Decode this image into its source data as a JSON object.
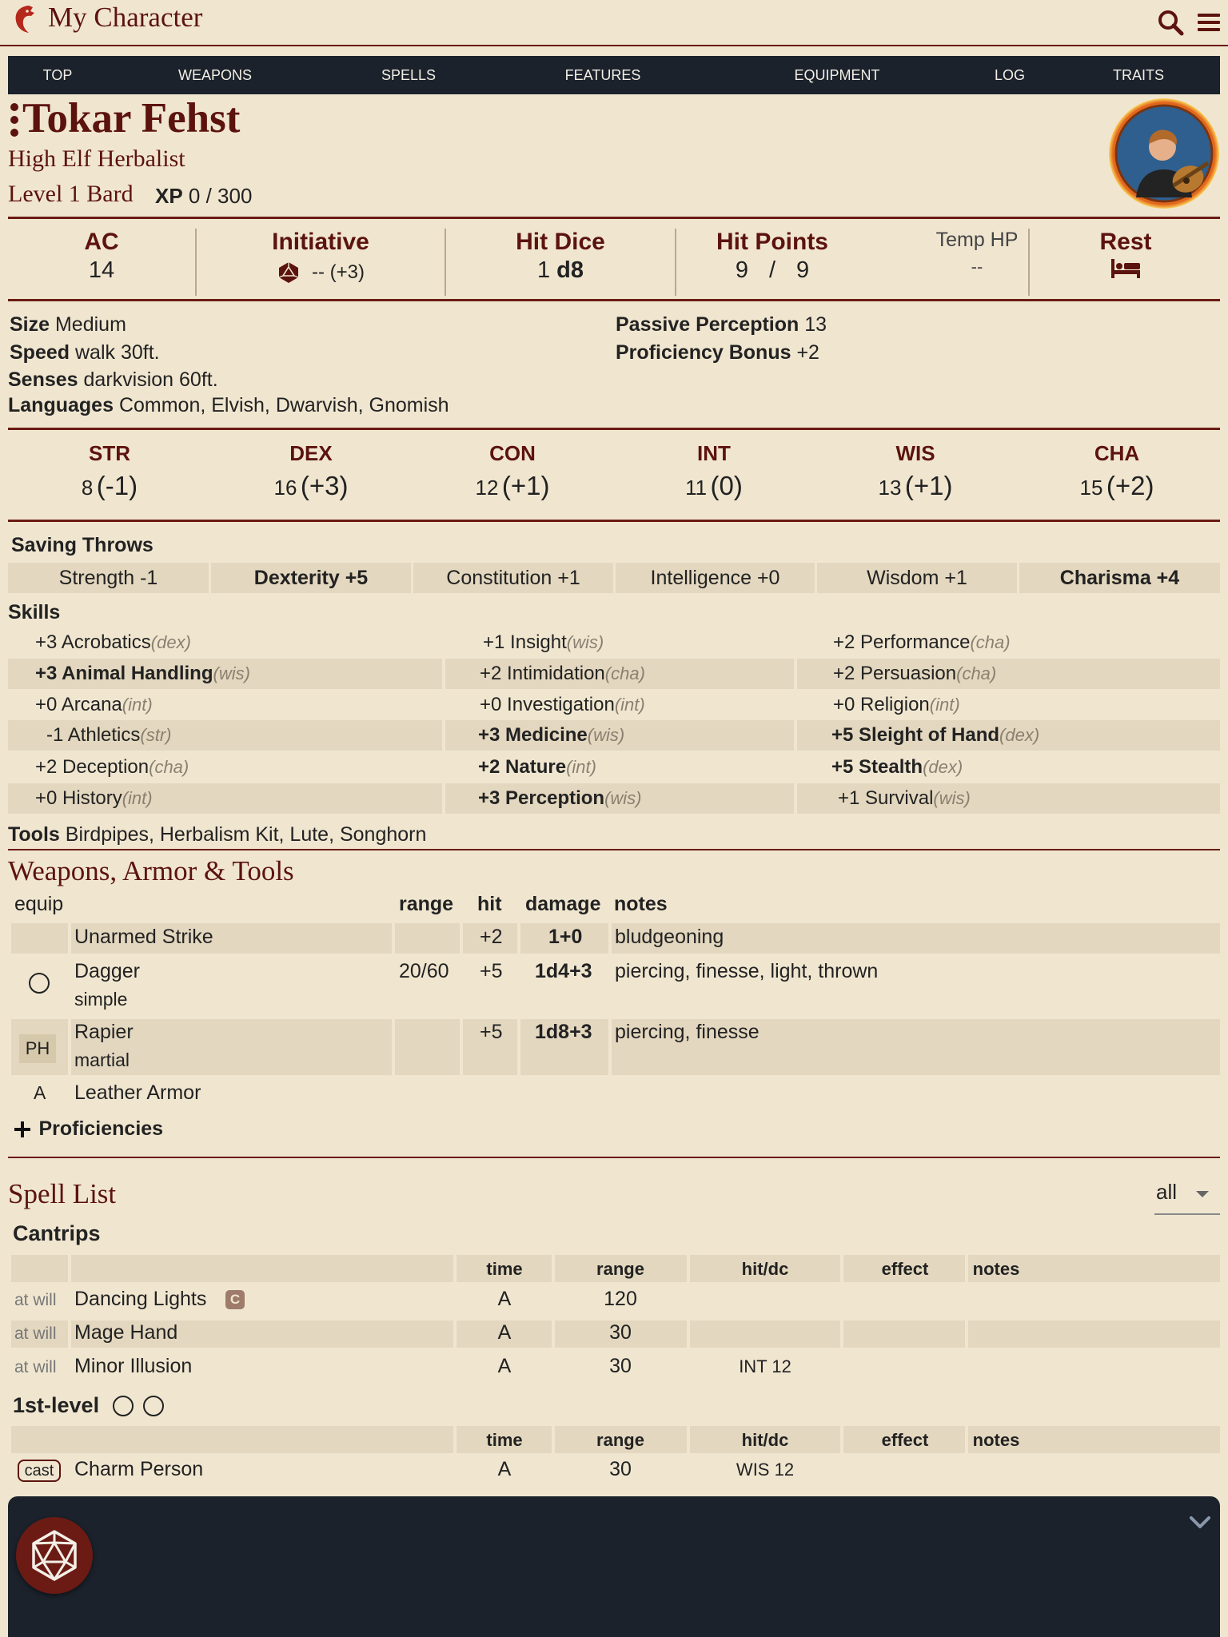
{
  "app": {
    "title": "My Character"
  },
  "nav": {
    "items": [
      "TOP",
      "WEAPONS",
      "SPELLS",
      "FEATURES",
      "EQUIPMENT",
      "LOG",
      "TRAITS"
    ]
  },
  "character": {
    "name": "Tokar Fehst",
    "subtitle": "High Elf Herbalist",
    "level_class": "Level 1 Bard",
    "xp_label": "XP",
    "xp_value": "0 / 300"
  },
  "stats": {
    "ac_label": "AC",
    "ac_value": "14",
    "initiative_label": "Initiative",
    "initiative_value": "-- (+3)",
    "hit_dice_label": "Hit Dice",
    "hit_dice_count": "1",
    "hit_dice_die": "d8",
    "hit_points_label": "Hit Points",
    "hp_current": "9",
    "hp_sep": "/",
    "hp_max": "9",
    "temp_hp_label": "Temp HP",
    "temp_hp_value": "--",
    "rest_label": "Rest"
  },
  "info": {
    "size_label": "Size",
    "size_value": "Medium",
    "speed_label": "Speed",
    "speed_value": "walk 30ft.",
    "senses_label": "Senses",
    "senses_value": "darkvision 60ft.",
    "languages_label": "Languages",
    "languages_value": "Common, Elvish, Dwarvish, Gnomish",
    "passive_label": "Passive Perception",
    "passive_value": "13",
    "prof_label": "Proficiency Bonus",
    "prof_value": "+2"
  },
  "abilities": [
    {
      "label": "STR",
      "score": "8",
      "mod": "(-1)"
    },
    {
      "label": "DEX",
      "score": "16",
      "mod": "(+3)"
    },
    {
      "label": "CON",
      "score": "12",
      "mod": "(+1)"
    },
    {
      "label": "INT",
      "score": "11",
      "mod": "(0)"
    },
    {
      "label": "WIS",
      "score": "13",
      "mod": "(+1)"
    },
    {
      "label": "CHA",
      "score": "15",
      "mod": "(+2)"
    }
  ],
  "saving_throws": {
    "title": "Saving Throws",
    "items": [
      {
        "label": "Strength -1",
        "proficient": false
      },
      {
        "label": "Dexterity +5",
        "proficient": true
      },
      {
        "label": "Constitution +1",
        "proficient": false
      },
      {
        "label": "Intelligence +0",
        "proficient": false
      },
      {
        "label": "Wisdom +1",
        "proficient": false
      },
      {
        "label": "Charisma +4",
        "proficient": true
      }
    ]
  },
  "skills": {
    "title": "Skills",
    "columns": [
      [
        {
          "mod": "+3",
          "name": "Acrobatics",
          "ability": "(dex)",
          "proficient": false
        },
        {
          "mod": "+3",
          "name": "Animal Handling",
          "ability": "(wis)",
          "proficient": true
        },
        {
          "mod": "+0",
          "name": "Arcana",
          "ability": "(int)",
          "proficient": false
        },
        {
          "mod": "-1",
          "name": "Athletics",
          "ability": "(str)",
          "proficient": false
        },
        {
          "mod": "+2",
          "name": "Deception",
          "ability": "(cha)",
          "proficient": false
        },
        {
          "mod": "+0",
          "name": "History",
          "ability": "(int)",
          "proficient": false
        }
      ],
      [
        {
          "mod": "+1",
          "name": "Insight",
          "ability": "(wis)",
          "proficient": false
        },
        {
          "mod": "+2",
          "name": "Intimidation",
          "ability": "(cha)",
          "proficient": false
        },
        {
          "mod": "+0",
          "name": "Investigation",
          "ability": "(int)",
          "proficient": false
        },
        {
          "mod": "+3",
          "name": "Medicine",
          "ability": "(wis)",
          "proficient": true
        },
        {
          "mod": "+2",
          "name": "Nature",
          "ability": "(int)",
          "proficient": true
        },
        {
          "mod": "+3",
          "name": "Perception",
          "ability": "(wis)",
          "proficient": true
        }
      ],
      [
        {
          "mod": "+2",
          "name": "Performance",
          "ability": "(cha)",
          "proficient": false
        },
        {
          "mod": "+2",
          "name": "Persuasion",
          "ability": "(cha)",
          "proficient": false
        },
        {
          "mod": "+0",
          "name": "Religion",
          "ability": "(int)",
          "proficient": false
        },
        {
          "mod": "+5",
          "name": "Sleight of Hand",
          "ability": "(dex)",
          "proficient": true
        },
        {
          "mod": "+5",
          "name": "Stealth",
          "ability": "(dex)",
          "proficient": true
        },
        {
          "mod": "+1",
          "name": "Survival",
          "ability": "(wis)",
          "proficient": false
        }
      ]
    ],
    "tools_label": "Tools",
    "tools_value": "Birdpipes, Herbalism Kit, Lute, Songhorn"
  },
  "weapons": {
    "title": "Weapons, Armor & Tools",
    "headers": {
      "equip": "equip",
      "range": "range",
      "hit": "hit",
      "damage": "damage",
      "notes": "notes"
    },
    "rows": [
      {
        "equip": "",
        "name": "Unarmed Strike",
        "sub": "",
        "range": "",
        "hit": "+2",
        "damage": "1+0",
        "notes": "bludgeoning"
      },
      {
        "equip": "circle",
        "name": "Dagger",
        "sub": "simple",
        "range": "20/60",
        "hit": "+5",
        "damage": "1d4+3",
        "notes": "piercing, finesse, light, thrown"
      },
      {
        "equip": "PH",
        "name": "Rapier",
        "sub": "martial",
        "range": "",
        "hit": "+5",
        "damage": "1d8+3",
        "notes": "piercing, finesse"
      },
      {
        "equip": "A",
        "name": "Leather Armor",
        "sub": "",
        "range": "",
        "hit": "",
        "damage": "",
        "notes": ""
      }
    ],
    "proficiencies_label": "Proficiencies"
  },
  "spells": {
    "title": "Spell List",
    "filter_value": "all",
    "headers": {
      "time": "time",
      "range": "range",
      "hitdc": "hit/dc",
      "effect": "effect",
      "notes": "notes"
    },
    "cantrips_title": "Cantrips",
    "cantrips": [
      {
        "use": "at will",
        "name": "Dancing Lights",
        "badge": "C",
        "time": "A",
        "range": "120",
        "hitdc": ""
      },
      {
        "use": "at will",
        "name": "Mage Hand",
        "badge": "",
        "time": "A",
        "range": "30",
        "hitdc": ""
      },
      {
        "use": "at will",
        "name": "Minor Illusion",
        "badge": "",
        "time": "A",
        "range": "30",
        "hitdc": "INT 12"
      }
    ],
    "level1_title": "1st-level",
    "level1": [
      {
        "use": "cast",
        "name": "Charm Person",
        "time": "A",
        "range": "30",
        "hitdc": "WIS 12"
      }
    ]
  },
  "colors": {
    "accent": "#5c130e",
    "background": "#f0e6d0",
    "nav": "#1b222c",
    "cell": "#e3d7bf"
  }
}
